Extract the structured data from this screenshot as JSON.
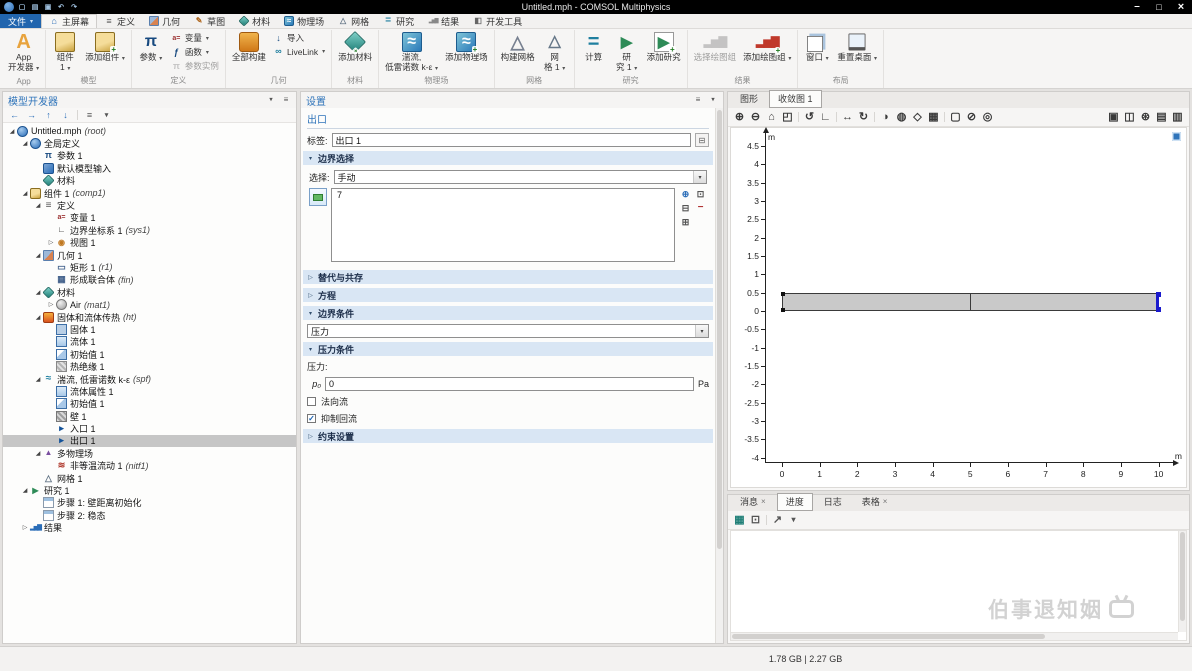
{
  "titlebar": {
    "title": "Untitled.mph - COMSOL Multiphysics",
    "quick_icons": [
      "comsol-logo-icon",
      "new-icon",
      "open-icon",
      "save-icon",
      "undo-icon",
      "redo-icon"
    ],
    "window_controls": [
      "minimize-icon",
      "maximize-icon",
      "close-icon"
    ]
  },
  "menubar": {
    "file_label": "文件",
    "tabs": [
      {
        "name": "tab-home",
        "label": "主屏幕",
        "icon": "home-icon",
        "active": true
      },
      {
        "name": "tab-definitions",
        "label": "定义",
        "icon": "definitions-icon"
      },
      {
        "name": "tab-geometry",
        "label": "几何",
        "icon": "geometry-icon"
      },
      {
        "name": "tab-sketch",
        "label": "草图",
        "icon": "sketch-icon"
      },
      {
        "name": "tab-materials",
        "label": "材料",
        "icon": "material-icon"
      },
      {
        "name": "tab-physics",
        "label": "物理场",
        "icon": "turbulence-icon"
      },
      {
        "name": "tab-mesh",
        "label": "网格",
        "icon": "mesh-icon"
      },
      {
        "name": "tab-study",
        "label": "研究",
        "icon": "compute-icon"
      },
      {
        "name": "tab-results",
        "label": "结果",
        "icon": "plot-group-icon"
      },
      {
        "name": "tab-developer-tools",
        "label": "开发工具",
        "icon": "devtools-icon"
      }
    ]
  },
  "ribbon": {
    "groups": [
      {
        "label": "App",
        "items": [
          {
            "name": "app-builder-button",
            "icon": "app-icon",
            "lines": [
              "App",
              "开发器"
            ],
            "dd": true
          }
        ]
      },
      {
        "label": "模型",
        "items": [
          {
            "name": "component-1-button",
            "icon": "component-icon",
            "lines": [
              "组件",
              "1"
            ],
            "dd": true
          },
          {
            "name": "add-component-button",
            "icon": "add-component-icon",
            "lines": [
              "添加组件"
            ],
            "dd": true
          }
        ]
      },
      {
        "label": "定义",
        "items": [
          {
            "name": "parameters-button",
            "icon": "pi-icon",
            "lines": [
              "参数"
            ],
            "dd": true
          },
          {
            "col": [
              {
                "name": "variables-button",
                "icon": "variable-icon",
                "label": "变量",
                "dd": true
              },
              {
                "name": "functions-button",
                "icon": "function-icon",
                "label": "函数",
                "dd": true
              },
              {
                "name": "parameter-case-button",
                "icon": "parameter-case-icon",
                "label": "参数实例",
                "disabled": true
              }
            ]
          }
        ]
      },
      {
        "label": "几何",
        "items": [
          {
            "name": "build-all-button",
            "icon": "build-all-icon",
            "lines": [
              "全部构建"
            ]
          },
          {
            "col": [
              {
                "name": "import-button",
                "icon": "import-icon",
                "label": "导入"
              },
              {
                "name": "livelink-button",
                "icon": "livelink-icon",
                "label": "LiveLink",
                "dd": true
              }
            ]
          }
        ]
      },
      {
        "label": "材料",
        "items": [
          {
            "name": "add-material-button",
            "icon": "add-material-icon",
            "lines": [
              "添加材料"
            ]
          }
        ]
      },
      {
        "label": "物理场",
        "items": [
          {
            "name": "physics-interface-button",
            "icon": "turbulence-icon",
            "lines": [
              "湍流,",
              "低雷诺数 k-ε"
            ],
            "dd": true
          },
          {
            "name": "add-physics-button",
            "icon": "add-physics-icon",
            "lines": [
              "添加物理场"
            ]
          }
        ]
      },
      {
        "label": "网格",
        "items": [
          {
            "name": "build-mesh-button",
            "icon": "build-mesh-icon",
            "lines": [
              "构建网格"
            ]
          },
          {
            "name": "mesh-1-button",
            "icon": "mesh-icon",
            "lines": [
              "网",
              "格 1"
            ],
            "dd": true
          }
        ]
      },
      {
        "label": "研究",
        "items": [
          {
            "name": "compute-button",
            "icon": "compute-icon",
            "lines": [
              "计算"
            ]
          },
          {
            "name": "study-1-button",
            "icon": "study-icon",
            "lines": [
              "研",
              "究 1"
            ],
            "dd": true
          },
          {
            "name": "add-study-button",
            "icon": "add-study-icon",
            "lines": [
              "添加研究"
            ]
          }
        ]
      },
      {
        "label": "结果",
        "items": [
          {
            "name": "select-plot-group-button",
            "icon": "plot-group-icon",
            "lines": [
              "选择绘图组"
            ],
            "disabled": true
          },
          {
            "name": "add-plot-group-button",
            "icon": "add-plot-group-icon",
            "lines": [
              "添加绘图组"
            ],
            "dd": true
          }
        ]
      },
      {
        "label": "布局",
        "items": [
          {
            "name": "windows-button",
            "icon": "window-icon",
            "lines": [
              "窗口"
            ],
            "dd": true
          },
          {
            "name": "reset-desktop-button",
            "icon": "reset-desktop-icon",
            "lines": [
              "重置桌面"
            ],
            "dd": true
          }
        ]
      }
    ]
  },
  "model_builder": {
    "title": "模型开发器",
    "header_icons": [
      "dropdown-icon",
      "menu-icon"
    ],
    "toolbar_icons": [
      "back-icon",
      "forward-icon",
      "move-up-icon",
      "move-down-icon",
      "sep",
      "collapse-all-icon",
      "filter-icon"
    ],
    "tree": [
      {
        "i": 0,
        "e": "open",
        "icon": "globe-icon",
        "label": "Untitled.mph",
        "suffix": "(root)"
      },
      {
        "i": 1,
        "e": "open",
        "icon": "globe-icon",
        "label": "全局定义"
      },
      {
        "i": 2,
        "icon": "pi-icon",
        "label": "参数 1"
      },
      {
        "i": 2,
        "icon": "model-input-icon",
        "label": "默认模型输入"
      },
      {
        "i": 2,
        "icon": "material-icon",
        "label": "材料"
      },
      {
        "i": 1,
        "e": "open",
        "icon": "component-icon",
        "label": "组件 1",
        "suffix": "(comp1)"
      },
      {
        "i": 2,
        "e": "open",
        "icon": "definitions-icon",
        "label": "定义"
      },
      {
        "i": 3,
        "icon": "variable-icon",
        "label": "变量 1"
      },
      {
        "i": 3,
        "icon": "coordsys-icon",
        "label": "边界坐标系 1",
        "suffix": "(sys1)"
      },
      {
        "i": 3,
        "e": "closed",
        "icon": "view-icon",
        "label": "视图 1"
      },
      {
        "i": 2,
        "e": "open",
        "icon": "geometry-icon",
        "label": "几何 1"
      },
      {
        "i": 3,
        "icon": "rectangle-icon",
        "label": "矩形 1",
        "suffix": "(r1)"
      },
      {
        "i": 3,
        "icon": "union-icon",
        "label": "形成联合体",
        "suffix": "(fin)"
      },
      {
        "i": 2,
        "e": "open",
        "icon": "material-icon",
        "label": "材料"
      },
      {
        "i": 3,
        "e": "closed",
        "icon": "air-icon",
        "label": "Air",
        "suffix": "(mat1)"
      },
      {
        "i": 2,
        "e": "open",
        "icon": "heat-icon",
        "label": "固体和流体传热",
        "suffix": "(ht)"
      },
      {
        "i": 3,
        "icon": "solid-icon",
        "label": "固体 1"
      },
      {
        "i": 3,
        "icon": "fluid-icon",
        "label": "流体 1"
      },
      {
        "i": 3,
        "icon": "initial-values-icon",
        "label": "初始值 1"
      },
      {
        "i": 3,
        "icon": "insulation-icon",
        "label": "热绝缘 1"
      },
      {
        "i": 2,
        "e": "open",
        "icon": "spf-icon",
        "label": "湍流, 低雷诺数 k-ε",
        "suffix": "(spf)"
      },
      {
        "i": 3,
        "icon": "fluid-properties-icon",
        "label": "流体属性 1"
      },
      {
        "i": 3,
        "icon": "initial-values-icon",
        "label": "初始值 1"
      },
      {
        "i": 3,
        "icon": "wall-icon",
        "label": "壁 1"
      },
      {
        "i": 3,
        "icon": "inlet-icon",
        "label": "入口 1"
      },
      {
        "i": 3,
        "icon": "outlet-icon",
        "label": "出口 1",
        "sel": true
      },
      {
        "i": 2,
        "e": "open",
        "icon": "multiphysics-icon",
        "label": "多物理场"
      },
      {
        "i": 3,
        "icon": "nitf-icon",
        "label": "非等温流动 1",
        "suffix": "(nitf1)"
      },
      {
        "i": 2,
        "icon": "mesh-icon",
        "label": "网格 1"
      },
      {
        "i": 1,
        "e": "open",
        "icon": "study-icon",
        "label": "研究 1"
      },
      {
        "i": 2,
        "icon": "step-icon",
        "label": "步骤 1: 壁距离初始化"
      },
      {
        "i": 2,
        "icon": "step-icon",
        "label": "步骤 2: 稳态"
      },
      {
        "i": 1,
        "e": "closed",
        "icon": "results-icon",
        "label": "结果"
      }
    ]
  },
  "settings": {
    "panel_title": "设置",
    "header_icons": [
      "menu-icon",
      "dropdown-icon"
    ],
    "node_type": "出口",
    "label_caption": "标签:",
    "label_value": "出口 1",
    "sections": [
      {
        "id": "boundary_selection",
        "label": "边界选择",
        "expanded": true
      },
      {
        "id": "override",
        "label": "替代与共存",
        "expanded": false
      },
      {
        "id": "equation",
        "label": "方程",
        "expanded": false
      },
      {
        "id": "boundary_condition",
        "label": "边界条件",
        "expanded": true
      },
      {
        "id": "pressure_conditions",
        "label": "压力条件",
        "expanded": true
      },
      {
        "id": "constraint",
        "label": "约束设置",
        "expanded": false
      }
    ],
    "selection_caption": "选择:",
    "selection_mode": "手动",
    "selected_boundaries": [
      "7"
    ],
    "selection_toolbar_icons": [
      "new-selection-icon",
      "copy-selection-icon",
      "paste-selection-icon",
      "remove-selection-icon",
      "zoom-selection-icon"
    ],
    "bc_value": "压力",
    "pressure_caption": "压力:",
    "p0_symbol": "p₀",
    "p0_value": "0",
    "p0_unit": "Pa",
    "normal_flow": {
      "label": "法向流",
      "checked": false
    },
    "suppress_backflow": {
      "label": "抑制回流",
      "checked": true
    }
  },
  "graphics": {
    "tabs": [
      {
        "name": "tab-graphics",
        "label": "图形"
      },
      {
        "name": "tab-convergence-plot-1",
        "label": "收敛图 1",
        "active": true
      }
    ],
    "toolbar_icons": [
      "zoom-in-icon",
      "zoom-out-icon",
      "zoom-extents-icon",
      "zoom-box-icon",
      "sep",
      "default-view-icon",
      "axis-icon",
      "sep",
      "pan-icon",
      "rotate-icon",
      "sep",
      "scene-light-icon",
      "transparency-icon",
      "wireframe-icon",
      "mesh-view-icon",
      "sep",
      "select-box-icon",
      "deselect-icon",
      "zoom-selected-icon",
      "gap",
      "screenshot-icon",
      "image-export-icon",
      "gear-icon",
      "camera-icon",
      "print-icon"
    ],
    "plot": {
      "x_ticks": [
        0,
        1,
        2,
        3,
        4,
        5,
        6,
        7,
        8,
        9,
        10
      ],
      "y_ticks": [
        4.5,
        4,
        3.5,
        3,
        2.5,
        2,
        1.5,
        1,
        0.5,
        0,
        -0.5,
        -1,
        -1.5,
        -2,
        -2.5,
        -3,
        -3.5,
        -4
      ],
      "x_range": [
        -0.45,
        10.25
      ],
      "y_range": [
        -4.15,
        4.72
      ],
      "x_unit": "m",
      "y_unit": "m",
      "geometry": {
        "x0": 0,
        "x1": 10,
        "y0": 0,
        "y1": 0.5,
        "divider_x": 5,
        "fill": "#c9c9c9",
        "selected_color": "#1a1acd"
      }
    }
  },
  "messages": {
    "tabs": [
      {
        "name": "tab-messages",
        "label": "消息",
        "closable": true
      },
      {
        "name": "tab-progress",
        "label": "进度",
        "active": true
      },
      {
        "name": "tab-log",
        "label": "日志"
      },
      {
        "name": "tab-table",
        "label": "表格",
        "closable": true
      }
    ],
    "toolbar_icons": [
      "grid-icon",
      "copy-icon",
      "sep",
      "float-icon",
      "dropdown-icon"
    ]
  },
  "statusbar": {
    "memory": "1.78 GB | 2.27 GB"
  },
  "watermark": {
    "text": "伯事退知姻"
  }
}
